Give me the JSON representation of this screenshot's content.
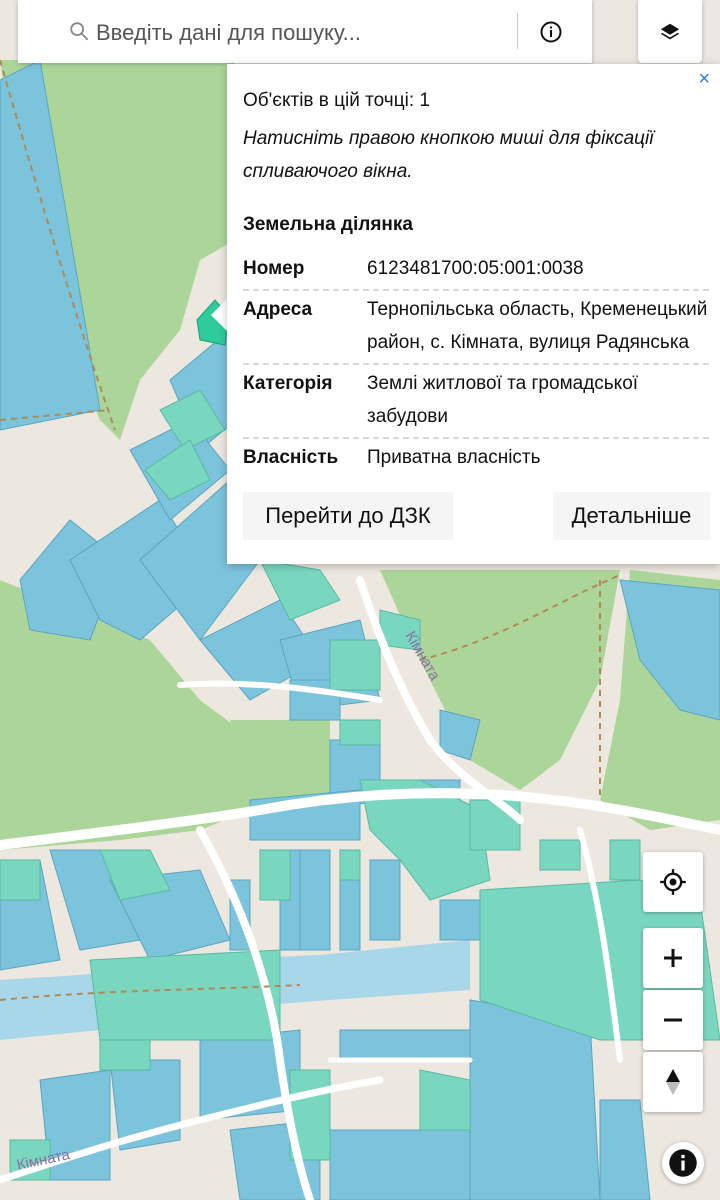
{
  "search": {
    "placeholder": "Введіть дані для пошуку..."
  },
  "icons": {
    "search": "search-icon",
    "info": "info-icon",
    "layers": "layers-icon",
    "locate": "locate-icon",
    "zoom_in": "plus-icon",
    "zoom_out": "minus-icon",
    "north": "compass-north-icon",
    "attribution": "info-circle-icon",
    "close": "close-icon"
  },
  "popup": {
    "close": "×",
    "count": "Об'єктів в цій точці: 1",
    "hint": "Натисніть правою кнопкою миші для фіксації спливаючого вікна.",
    "section": "Земельна ділянка",
    "rows": [
      {
        "key": "Номер",
        "value": "6123481700:05:001:0038"
      },
      {
        "key": "Адреса",
        "value": "Тернопільська область, Кременецький район, с. Кімната, вулиця Радянська"
      },
      {
        "key": "Категорія",
        "value": "Землі житлової та громадської забудови"
      },
      {
        "key": "Власність",
        "value": "Приватна власність"
      }
    ],
    "btn_dzk": "Перейти до ДЗК",
    "btn_detail": "Детальніше"
  },
  "map": {
    "street_labels": [
      "Кімната",
      "Кімната"
    ],
    "colors": {
      "background": "#e9e4dc",
      "forest": "#a9d393",
      "parcel_blue": "#7cc3dc",
      "parcel_teal": "#7ad7bf",
      "selected_parcel": "#2ecc9a",
      "water": "#a7d6ea",
      "road": "#ffffff",
      "boundary": "#b08a55"
    }
  }
}
